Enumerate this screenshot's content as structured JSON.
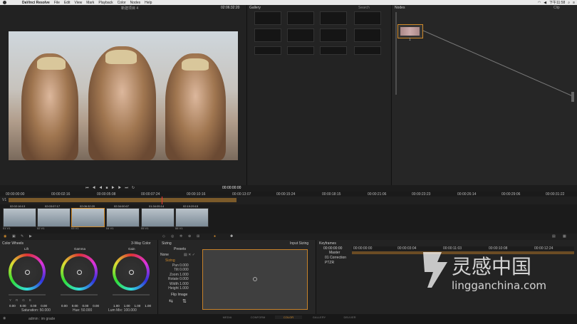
{
  "menubar": {
    "app": "DaVinci Resolve",
    "items": [
      "File",
      "Edit",
      "View",
      "Mark",
      "Playback",
      "Color",
      "Nodes",
      "Help"
    ],
    "clock": "下午11:58"
  },
  "viewer": {
    "project": "新建项目 4",
    "timecode": "02:06:32:20",
    "transport_tc": "00:00:00:00"
  },
  "gallery": {
    "title": "Gallery",
    "search_placeholder": "Search"
  },
  "nodes": {
    "title": "Nodes",
    "mode": "Clip",
    "node_label": "1"
  },
  "ruler": {
    "ticks": [
      "00:00:00:00",
      "00:00:02:16",
      "00:00:05:08",
      "00:00:07:24",
      "00:00:10:16",
      "00:00:13:07",
      "00:00:15:24",
      "00:00:18:15",
      "00:00:21:06",
      "00:00:23:23",
      "00:00:26:14",
      "00:00:29:06",
      "00:00:31:22"
    ]
  },
  "timeline": {
    "track": "V1"
  },
  "clips": [
    {
      "tc": "02:02:16:13",
      "label": "01 V1"
    },
    {
      "tc": "02:03:07:17",
      "label": "02 V1"
    },
    {
      "tc": "02:06:32:20",
      "label": "03 V1"
    },
    {
      "tc": "02:34:00:07",
      "label": "04 V1"
    },
    {
      "tc": "01:34:05:14",
      "label": "05 V1"
    },
    {
      "tc": "02:19:29:15",
      "label": "06 V1"
    }
  ],
  "color_wheels": {
    "title": "Color Wheels",
    "mode": "3-Way Color",
    "wheels": [
      {
        "name": "Lift",
        "values": [
          "0.00",
          "0.00",
          "0.00",
          "0.00"
        ]
      },
      {
        "name": "Gamma",
        "values": [
          "0.00",
          "0.00",
          "0.00",
          "0.00"
        ]
      },
      {
        "name": "Gain",
        "values": [
          "1.00",
          "1.00",
          "1.00",
          "1.00"
        ]
      }
    ],
    "channels": [
      "Y",
      "R",
      "G",
      "B"
    ],
    "saturation": "Saturation: 50.000",
    "hue": "Hue: 50.000",
    "lum_mix": "Lum Mix: 100.000"
  },
  "sizing": {
    "title": "Sizing",
    "input": "Input Sizing",
    "presets": "Presets",
    "preset_value": "None",
    "active": "Sizing",
    "params": [
      {
        "k": "Pan",
        "v": "0.000"
      },
      {
        "k": "Tilt",
        "v": "0.000"
      },
      {
        "k": "Zoom",
        "v": "1.000"
      },
      {
        "k": "Rotate",
        "v": "0.000"
      },
      {
        "k": "Width",
        "v": "1.000"
      },
      {
        "k": "Height",
        "v": "1.000"
      }
    ],
    "flip": "Flip Image"
  },
  "keyframes": {
    "title": "Keyframes",
    "tc": "00:00:00:00",
    "ruler": [
      "00:00:00:00",
      "00:00:03:04",
      "00:00:11:03",
      "00:00:10:08",
      "00:00:12:24"
    ],
    "tracks": [
      "Master",
      "01 Correction",
      "PTZR"
    ]
  },
  "status": {
    "user": "admin : im grade",
    "pages": [
      "MEDIA",
      "CONFORM",
      "COLOR",
      "GALLERY",
      "DELIVER"
    ]
  },
  "watermark": {
    "line1": "灵感中国",
    "line2": "lingganchina.com"
  },
  "colors": {
    "accent": "#d08a2a",
    "bg": "#262626"
  }
}
